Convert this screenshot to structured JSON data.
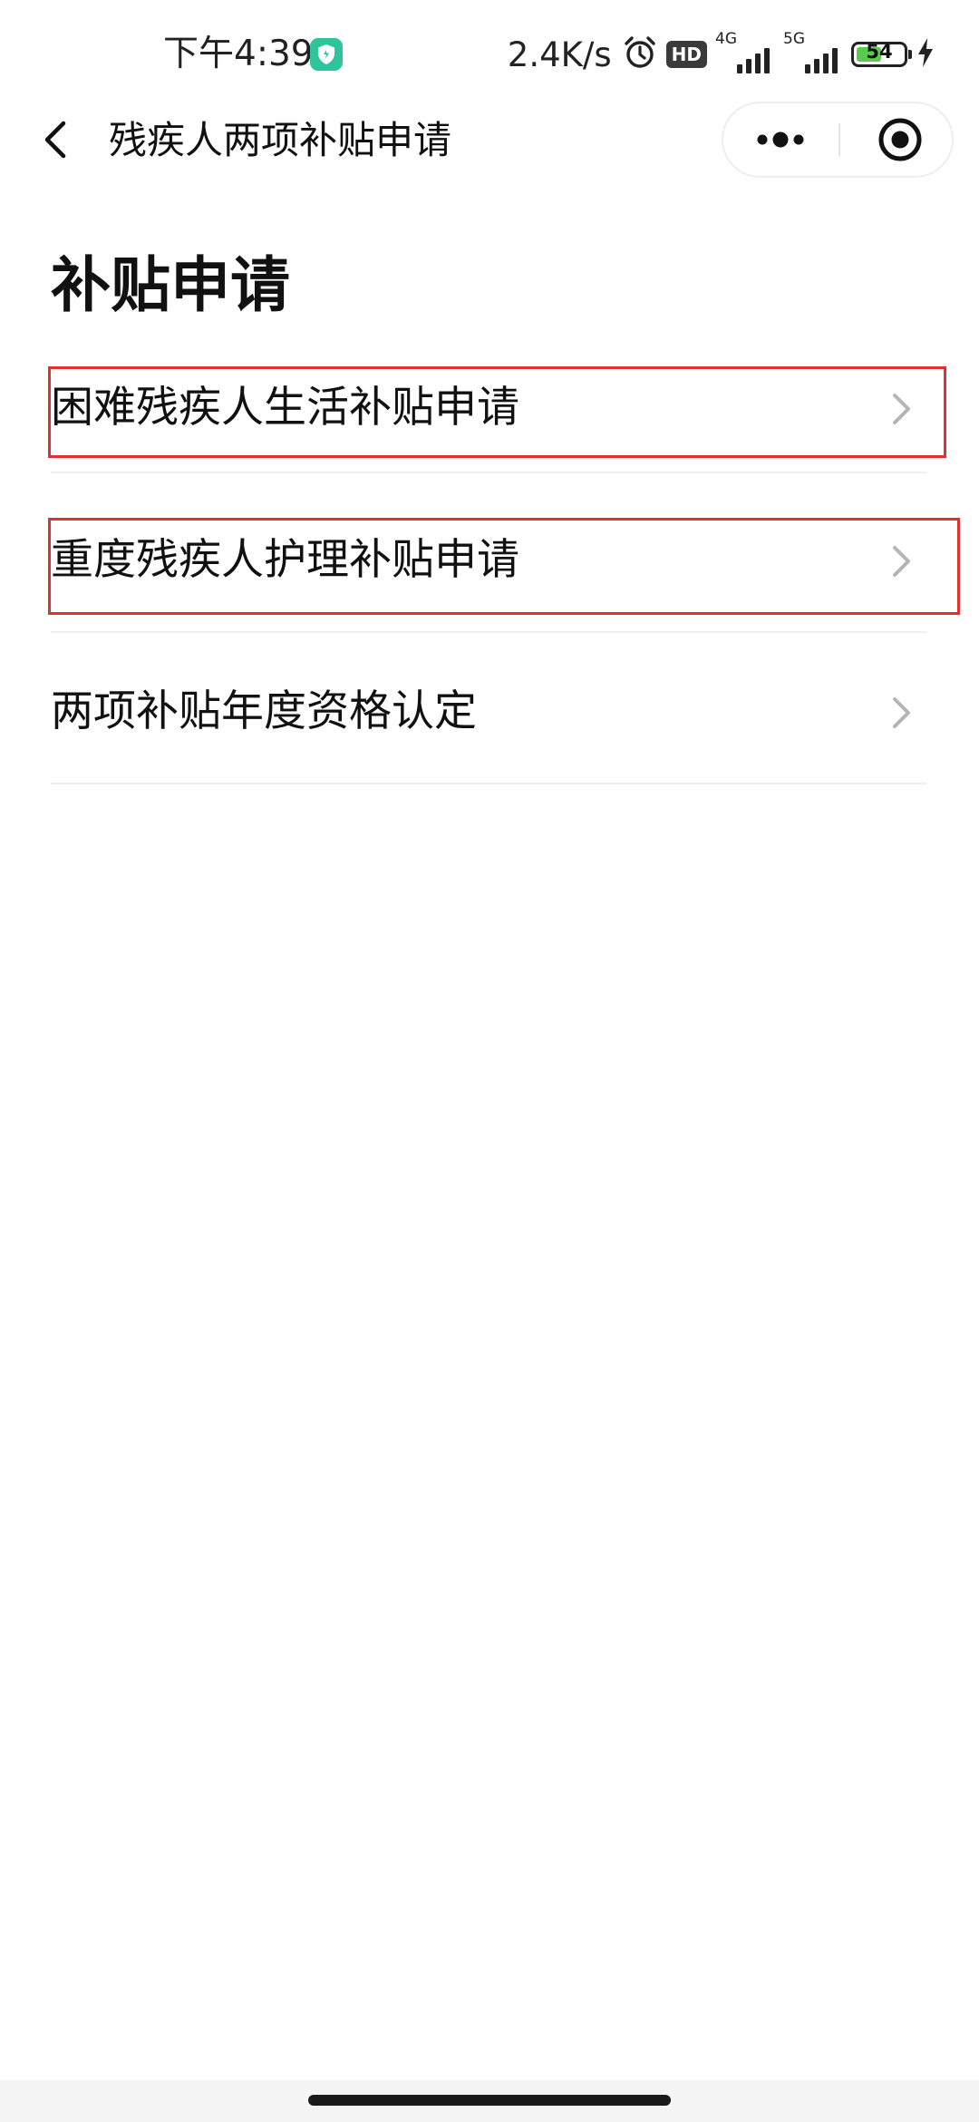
{
  "status_bar": {
    "time": "下午4:39",
    "network_speed": "2.4K/s",
    "hd_badge": "HD",
    "sim1_label": "4G",
    "sim2_label": "5G",
    "battery_level": "54",
    "battery_fraction": 0.54,
    "accent_color": "#2fc59a"
  },
  "nav": {
    "title": "残疾人两项补贴申请",
    "back_icon": "chevron-left-icon",
    "more_icon": "more-dots-icon",
    "close_icon": "target-close-icon"
  },
  "page": {
    "heading": "补贴申请"
  },
  "menu": {
    "items": [
      {
        "label": "困难残疾人生活补贴申请",
        "highlighted": true
      },
      {
        "label": "重度残疾人护理补贴申请",
        "highlighted": true
      },
      {
        "label": "两项补贴年度资格认定",
        "highlighted": false
      }
    ]
  },
  "colors": {
    "highlight_border": "#e0312f",
    "divider": "#efefef",
    "arrow": "#b5b5b5"
  }
}
